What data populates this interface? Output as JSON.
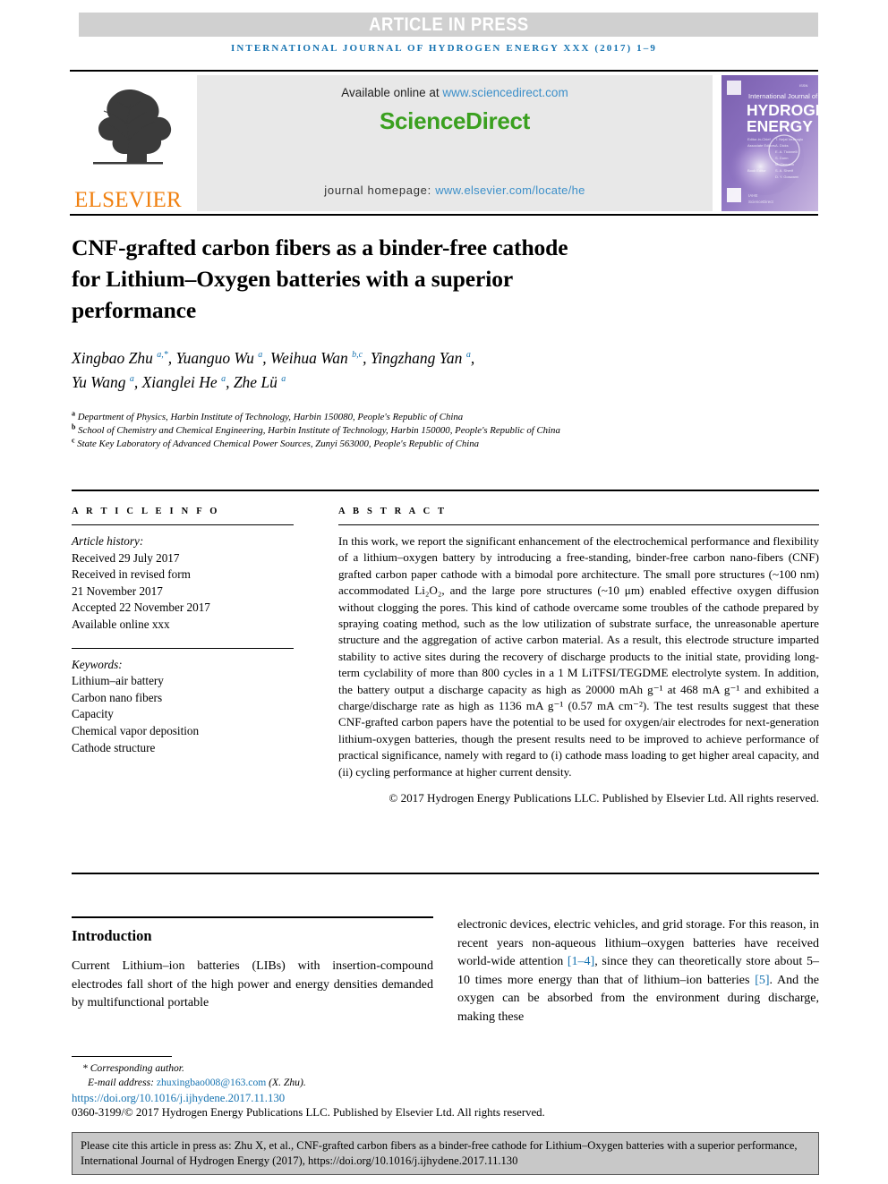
{
  "banner": {
    "article_in_press": "ARTICLE IN PRESS",
    "journal_reference": "INTERNATIONAL JOURNAL OF HYDROGEN ENERGY XXX (2017) 1–9"
  },
  "masthead": {
    "publisher_logo_text": "ELSEVIER",
    "available_online_prefix": "Available online at ",
    "available_online_url": "www.sciencedirect.com",
    "sciencedirect_logo": "ScienceDirect",
    "homepage_label": "journal homepage: ",
    "homepage_url": "www.elsevier.com/locate/he",
    "cover": {
      "line1": "International Journal of",
      "line2": "HYDROGEN",
      "line3": "ENERGY"
    }
  },
  "article": {
    "title_line1": "CNF-grafted carbon fibers as a binder-free cathode",
    "title_line2": "for Lithium–Oxygen batteries with a superior",
    "title_line3": "performance",
    "authors": [
      {
        "name": "Xingbao Zhu",
        "marks": "a,*",
        "sep": ", "
      },
      {
        "name": "Yuanguo Wu",
        "marks": "a",
        "sep": ", "
      },
      {
        "name": "Weihua Wan",
        "marks": "b,c",
        "sep": ", "
      },
      {
        "name": "Yingzhang Yan",
        "marks": "a",
        "sep": ","
      },
      {
        "name": "Yu Wang",
        "marks": "a",
        "sep": ", "
      },
      {
        "name": "Xianglei He",
        "marks": "a",
        "sep": ", "
      },
      {
        "name": "Zhe Lü",
        "marks": "a",
        "sep": ""
      }
    ],
    "affiliations": [
      {
        "mark": "a",
        "text": "Department of Physics, Harbin Institute of Technology, Harbin 150080, People's Republic of China"
      },
      {
        "mark": "b",
        "text": "School of Chemistry and Chemical Engineering, Harbin Institute of Technology, Harbin 150000, People's Republic of China"
      },
      {
        "mark": "c",
        "text": "State Key Laboratory of Advanced Chemical Power Sources, Zunyi 563000, People's Republic of China"
      }
    ]
  },
  "article_info": {
    "kicker": "A R T I C L E  I N F O",
    "history_label": "Article history:",
    "history_lines": [
      "Received 29 July 2017",
      "Received in revised form",
      "21 November 2017",
      "Accepted 22 November 2017",
      "Available online xxx"
    ],
    "keywords_label": "Keywords:",
    "keywords": [
      "Lithium–air battery",
      "Carbon nano fibers",
      "Capacity",
      "Chemical vapor deposition",
      "Cathode structure"
    ]
  },
  "abstract": {
    "kicker": "A B S T R A C T",
    "body": "In this work, we report the significant enhancement of the electrochemical performance and flexibility of a lithium–oxygen battery by introducing a free-standing, binder-free carbon nano-fibers (CNF) grafted carbon paper cathode with a bimodal pore architecture. The small pore structures (~100 nm) accommodated Li₂O₂, and the large pore structures (~10 μm) enabled effective oxygen diffusion without clogging the pores. This kind of cathode overcame some troubles of the cathode prepared by spraying coating method, such as the low utilization of substrate surface, the unreasonable aperture structure and the aggregation of active carbon material. As a result, this electrode structure imparted stability to active sites during the recovery of discharge products to the initial state, providing long-term cyclability of more than 800 cycles in a 1 M LiTFSI/TEGDME electrolyte system. In addition, the battery output a discharge capacity as high as 20000 mAh g⁻¹ at 468 mA g⁻¹ and exhibited a charge/discharge rate as high as 1136 mA g⁻¹ (0.57 mA cm⁻²). The test results suggest that these CNF-grafted carbon papers have the potential to be used for oxygen/air electrodes for next-generation lithium-oxygen batteries, though the present results need to be improved to achieve performance of practical significance, namely with regard to (i) cathode mass loading to get higher areal capacity, and (ii) cycling performance at higher current density.",
    "copyright": "© 2017 Hydrogen Energy Publications LLC. Published by Elsevier Ltd. All rights reserved."
  },
  "introduction": {
    "heading": "Introduction",
    "left_text": "Current Lithium–ion batteries (LIBs) with insertion-compound electrodes fall short of the high power and energy densities demanded by multifunctional portable",
    "right_text_part1": "electronic devices, electric vehicles, and grid storage. For this reason, in recent years non-aqueous lithium–oxygen batteries have received world-wide attention ",
    "right_ref1": "[1–4]",
    "right_text_part2": ", since they can theoretically store about 5–10 times more energy than that of lithium–ion batteries ",
    "right_ref2": "[5]",
    "right_text_part3": ". And the oxygen can be absorbed from the environment during discharge, making these"
  },
  "footnote": {
    "corresponding_marker": "*",
    "corresponding_label": "Corresponding author.",
    "email_label": "E-mail address: ",
    "email": "zhuxingbao008@163.com",
    "email_suffix": " (X. Zhu).",
    "doi": "https://doi.org/10.1016/j.ijhydene.2017.11.130",
    "issn_line": "0360-3199/© 2017 Hydrogen Energy Publications LLC. Published by Elsevier Ltd. All rights reserved."
  },
  "citation_box": {
    "text": "Please cite this article in press as: Zhu X, et al., CNF-grafted carbon fibers as a binder-free cathode for Lithium–Oxygen batteries with a superior performance, International Journal of Hydrogen Energy (2017), https://doi.org/10.1016/j.ijhydene.2017.11.130"
  },
  "colors": {
    "link_blue": "#1673b1",
    "sciencedirect_green": "#3aa01f",
    "elsevier_orange": "#f08010",
    "banner_gray": "#d0d0d0",
    "cite_box_gray": "#c8c8c8"
  }
}
